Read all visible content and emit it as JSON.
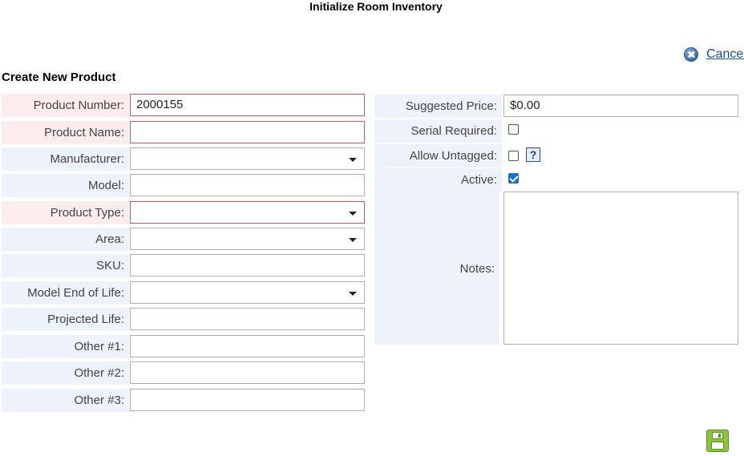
{
  "window": {
    "title": "Initialize Room Inventory"
  },
  "toolbar": {
    "cancel_label": "Cancel",
    "cancel_icon": "cancel-circle-icon"
  },
  "form": {
    "title": "Create New Product",
    "left_fields": [
      {
        "label": "Product Number:",
        "value": "2000155",
        "type": "text",
        "required": true
      },
      {
        "label": "Product Name:",
        "value": "",
        "type": "text",
        "required": true
      },
      {
        "label": "Manufacturer:",
        "value": "",
        "type": "select",
        "required": false
      },
      {
        "label": "Model:",
        "value": "",
        "type": "text",
        "required": false
      },
      {
        "label": "Product Type:",
        "value": "",
        "type": "select",
        "required": true
      },
      {
        "label": "Area:",
        "value": "",
        "type": "select",
        "required": false
      },
      {
        "label": "SKU:",
        "value": "",
        "type": "text",
        "required": false
      },
      {
        "label": "Model End of Life:",
        "value": "",
        "type": "select",
        "required": false
      },
      {
        "label": "Projected Life:",
        "value": "",
        "type": "text",
        "required": false
      },
      {
        "label": "Other #1:",
        "value": "",
        "type": "text",
        "required": false
      },
      {
        "label": "Other #2:",
        "value": "",
        "type": "text",
        "required": false
      },
      {
        "label": "Other #3:",
        "value": "",
        "type": "text",
        "required": false
      }
    ],
    "right_fields": {
      "suggested_price": {
        "label": "Suggested Price:",
        "value": "$0.00"
      },
      "serial_required": {
        "label": "Serial Required:",
        "checked": false
      },
      "allow_untagged": {
        "label": "Allow Untagged:",
        "checked": false,
        "help_icon": "help-icon",
        "help_glyph": "?"
      },
      "active": {
        "label": "Active:",
        "checked": true
      },
      "notes": {
        "label": "Notes:",
        "value": ""
      }
    },
    "save_icon": "save-disk-icon"
  },
  "colors": {
    "required_border": "#d8565f",
    "required_label_bg": "#fdeced",
    "label_bg": "#eef2fb",
    "link": "#1a4fa0",
    "checkbox_checked": "#1a6fd0",
    "save_green": "#8cc43f"
  }
}
